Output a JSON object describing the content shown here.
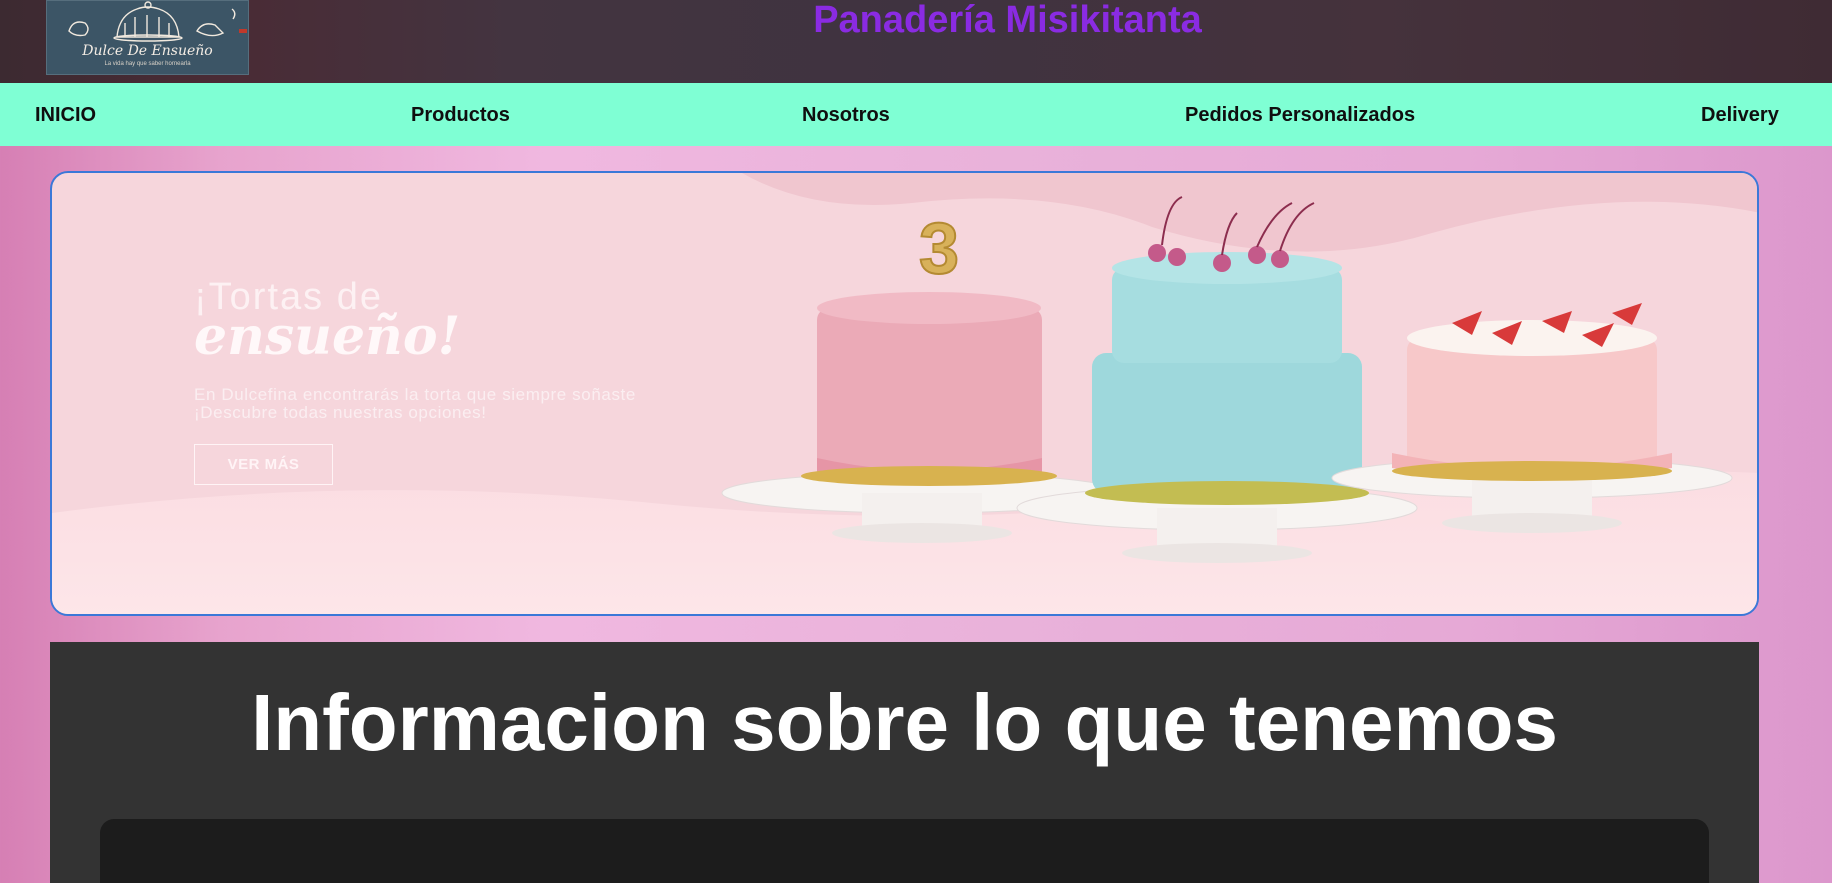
{
  "header": {
    "logo": {
      "name": "Dulce De Ensueño",
      "tagline": "La vida hay que saber hornearla"
    },
    "site_title": "Panadería Misikitanta"
  },
  "nav": {
    "items": [
      {
        "label": "INICIO"
      },
      {
        "label": "Productos"
      },
      {
        "label": "Nosotros"
      },
      {
        "label": "Pedidos Personalizados"
      },
      {
        "label": "Delivery"
      }
    ]
  },
  "banner": {
    "heading_line1": "¡Tortas de",
    "heading_line2": "ensueño!",
    "text": "En Dulcefina encontrarás la torta que siempre soñaste ¡Descubre todas nuestras opciones!",
    "button_label": "VER MÁS",
    "candle_number": "3"
  },
  "info": {
    "title": "Informacion sobre lo que tenemos"
  },
  "colors": {
    "nav_bg": "#7fffd4",
    "site_title": "#8a2be2",
    "banner_border": "#3b78d8",
    "info_bg": "#333333"
  }
}
